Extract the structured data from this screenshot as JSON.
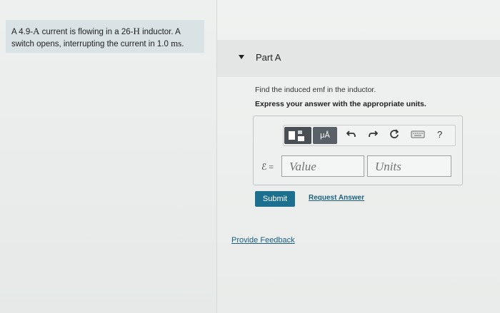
{
  "problem": {
    "text_part1": "A 4.9-",
    "current_unit": "A",
    "text_part2": " current is flowing in a 26-",
    "inductance_unit": "H",
    "text_part3": " inductor. A switch opens, interrupting the current in 1.0 ",
    "time_unit": "ms",
    "text_part4": "."
  },
  "part": {
    "title": "Part A",
    "question": "Find the induced emf in the inductor.",
    "instruction": "Express your answer with the appropriate units."
  },
  "toolbar": {
    "units_label": "μÅ",
    "help_label": "?",
    "icons": [
      "templates-icon",
      "units-icon",
      "undo-icon",
      "redo-icon",
      "reset-icon",
      "keyboard-icon",
      "help-icon"
    ]
  },
  "answer": {
    "symbol": "ℰ =",
    "value_placeholder": "Value",
    "units_placeholder": "Units"
  },
  "actions": {
    "submit_label": "Submit",
    "request_label": "Request Answer",
    "feedback_label": "Provide Feedback"
  },
  "colors": {
    "submit": "#1d6f8f",
    "link": "#1b5f7d",
    "problem_bg": "#d9e2e4"
  }
}
